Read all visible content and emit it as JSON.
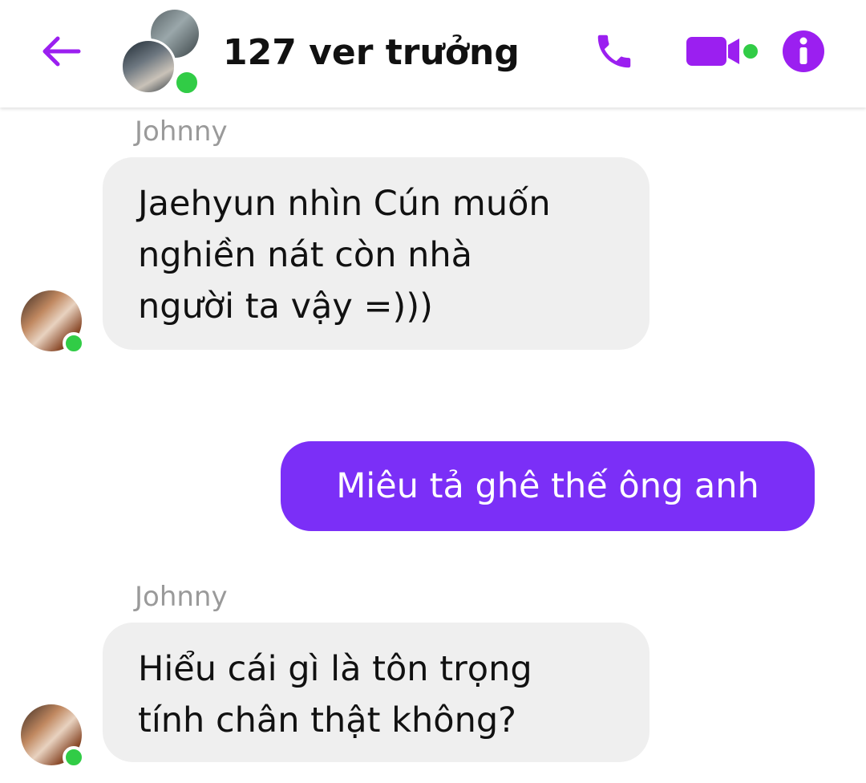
{
  "header": {
    "title": "127 ver trưởng",
    "back_icon": "arrow-left-icon",
    "call_icon": "phone-icon",
    "video_icon": "video-camera-icon",
    "info_icon": "info-icon",
    "accent_color": "#9b1ff0",
    "online_color": "#31cc46"
  },
  "messages": [
    {
      "sender": "Johnny",
      "direction": "incoming",
      "lines": [
        "Jaehyun nhìn Cún muốn",
        "nghiền nát còn nhà",
        "người ta vậy =)))"
      ]
    },
    {
      "direction": "outgoing",
      "text": "Miêu tả ghê thế ông anh",
      "bubble_color": "#7b2ff7"
    },
    {
      "sender": "Johnny",
      "direction": "incoming",
      "lines": [
        "Hiểu cái gì là tôn trọng",
        "tính chân thật không?"
      ]
    }
  ]
}
